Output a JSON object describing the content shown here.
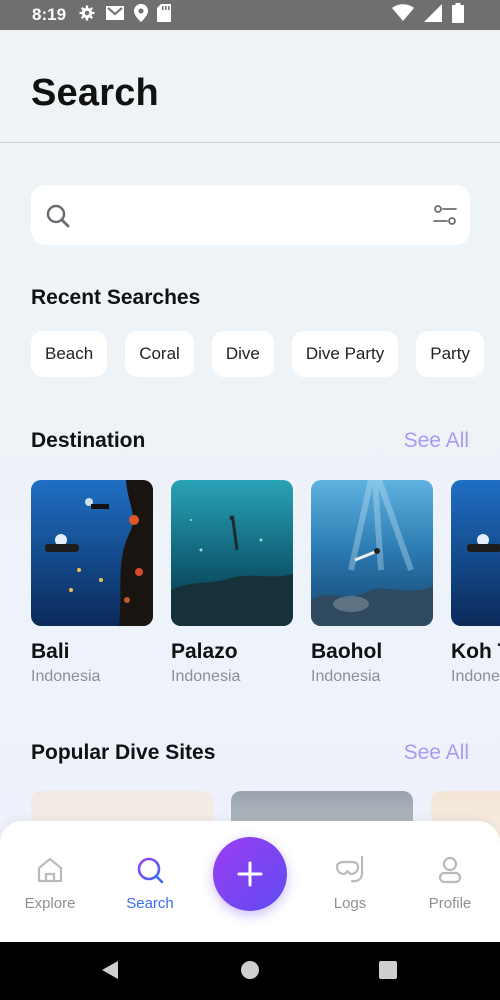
{
  "status_bar": {
    "time": "8:19",
    "left_icons": [
      "gear-icon",
      "mail-icon",
      "location-icon",
      "sd-card-icon"
    ],
    "right_icons": [
      "wifi-icon",
      "cell-signal-icon",
      "battery-icon"
    ]
  },
  "header": {
    "title": "Search"
  },
  "search": {
    "placeholder": "",
    "value": ""
  },
  "recent": {
    "title": "Recent Searches",
    "chips": [
      "Beach",
      "Coral",
      "Dive",
      "Dive Party",
      "Party"
    ]
  },
  "destination": {
    "title": "Destination",
    "see_all": "See All",
    "cards": [
      {
        "name": "Bali",
        "country": "Indonesia"
      },
      {
        "name": "Palazo",
        "country": "Indonesia"
      },
      {
        "name": "Baohol",
        "country": "Indonesia"
      },
      {
        "name": "Koh Tao",
        "country": "Indonesia"
      }
    ]
  },
  "popular": {
    "title": "Popular Dive Sites",
    "see_all": "See All"
  },
  "bottom_nav": {
    "items": [
      {
        "label": "Explore",
        "icon": "home-icon"
      },
      {
        "label": "Search",
        "icon": "search-icon"
      },
      {
        "label": "Logs",
        "icon": "snorkel-mask-icon"
      },
      {
        "label": "Profile",
        "icon": "person-icon"
      }
    ],
    "add_icon": "plus-icon"
  },
  "colors": {
    "accent": "#3a6df0",
    "see_all": "#a79bf0",
    "fab_start": "#9b3df2",
    "fab_end": "#5e4bf0"
  }
}
